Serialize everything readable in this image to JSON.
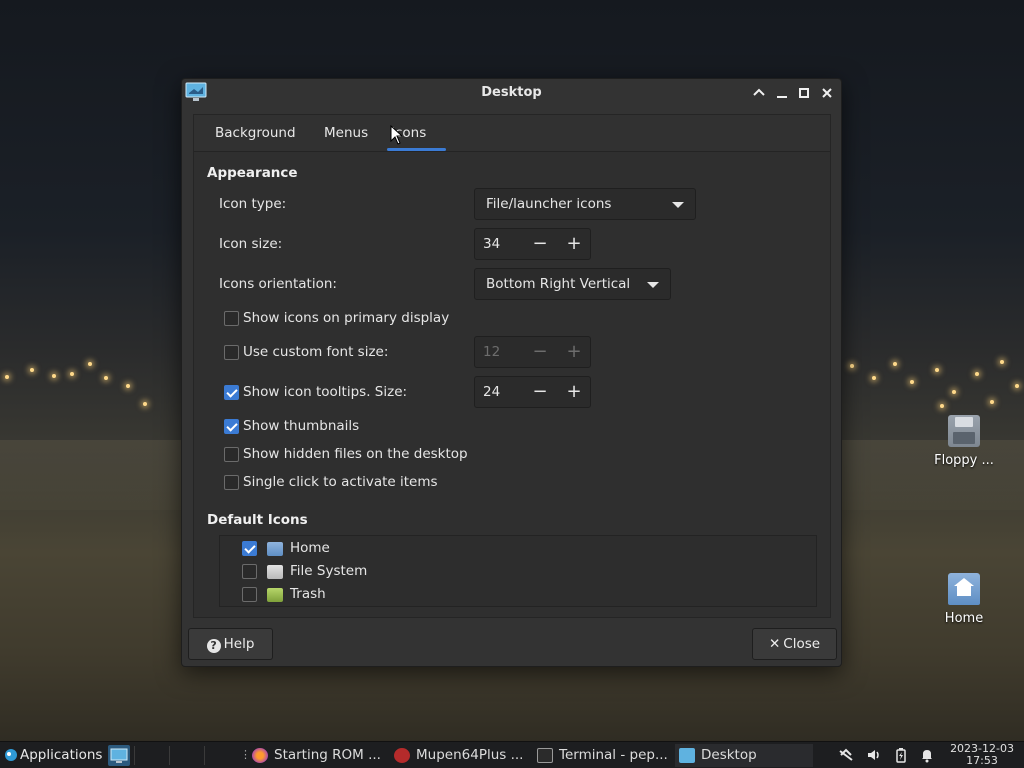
{
  "desktop": {
    "icons": [
      {
        "label": "Floppy ..."
      },
      {
        "label": "Home"
      }
    ]
  },
  "dialog": {
    "title": "Desktop",
    "tabs": [
      {
        "label": "Background"
      },
      {
        "label": "Menus"
      },
      {
        "label": "Icons",
        "active": true
      }
    ],
    "appearance": {
      "heading": "Appearance",
      "icon_type": {
        "label": "Icon type:",
        "value": "File/launcher icons"
      },
      "icon_size": {
        "label": "Icon size:",
        "value": "34"
      },
      "orientation": {
        "label": "Icons orientation:",
        "value": "Bottom Right Vertical"
      },
      "show_primary": {
        "label": "Show icons on primary display",
        "checked": false
      },
      "custom_font": {
        "label": "Use custom font size:",
        "checked": false,
        "value": "12"
      },
      "tooltips": {
        "label": "Show icon tooltips. Size:",
        "checked": true,
        "value": "24"
      },
      "thumbnails": {
        "label": "Show thumbnails",
        "checked": true
      },
      "hidden_files": {
        "label": "Show hidden files on the desktop",
        "checked": false
      },
      "single_click": {
        "label": "Single click to activate items",
        "checked": false
      }
    },
    "default_icons": {
      "heading": "Default Icons",
      "items": [
        {
          "label": "Home",
          "checked": true
        },
        {
          "label": "File System",
          "checked": false
        },
        {
          "label": "Trash",
          "checked": false
        }
      ]
    },
    "buttons": {
      "help": "Help",
      "close": "Close"
    }
  },
  "taskbar": {
    "applications": "Applications",
    "tasks": [
      {
        "label": "Starting ROM ..."
      },
      {
        "label": "Mupen64Plus ..."
      },
      {
        "label": "Terminal - pep..."
      },
      {
        "label": "Desktop",
        "active": true
      }
    ],
    "clock": {
      "date": "2023-12-03",
      "time": "17:53"
    }
  },
  "colors": {
    "accent": "#3b7bd4",
    "dialog_bg": "#333333",
    "taskbar_bg": "#1d1e20"
  }
}
